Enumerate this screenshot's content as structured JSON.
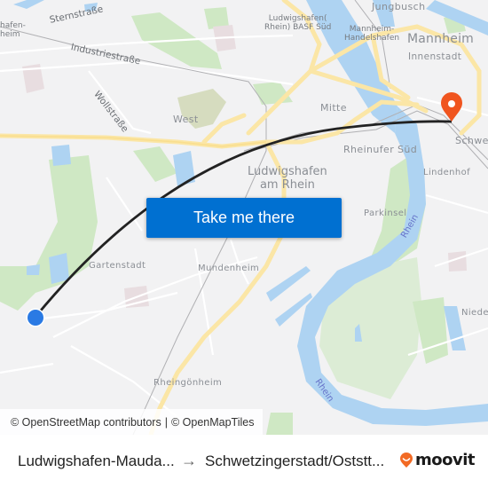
{
  "map": {
    "labels": {
      "sternstrasse": "Sternstraße",
      "industriestrasse": "Industriestraße",
      "wollstrasse": "Wollstraße",
      "ludwigshafen_edge_1": "hafen-",
      "ludwigshafen_edge_2": "heim",
      "west": "West",
      "basf_1": "Ludwigshafen(",
      "basf_2": "Rhein) BASF Süd",
      "jungbusch": "Jungbusch",
      "handelshafen_1": "Mannheim-",
      "handelshafen_2": "Handelshafen",
      "mannheim": "Mannheim",
      "innenstadt": "Innenstadt",
      "mitte": "Mitte",
      "rheinufer_sued": "Rheinufer Süd",
      "schwet": "Schwet",
      "ludwigshafen_1": "Ludwigshafen",
      "ludwigshafen_2": "am Rhein",
      "lindenhof": "Lindenhof",
      "parkinsel": "Parkinsel",
      "rhein_1": "Rhein",
      "rhein_2": "Rhein",
      "gartenstadt": "Gartenstadt",
      "mundenheim": "Mundenheim",
      "niede": "Niede",
      "rheingoenheim": "Rheingönheim"
    },
    "origin_marker_color": "#2a7ae4",
    "destination_marker_color": "#f0551f",
    "route_color": "#222222"
  },
  "cta": {
    "label": "Take me there",
    "color": "#0070d1"
  },
  "attribution": {
    "osm": "© OpenStreetMap contributors",
    "separator": "|",
    "omt": "© OpenMapTiles"
  },
  "footer": {
    "from": "Ludwigshafen-Mauda...",
    "arrow": "→",
    "to": "Schwetzingerstadt/Oststt...",
    "brand": "moovit",
    "brand_color": "#f26a24"
  }
}
